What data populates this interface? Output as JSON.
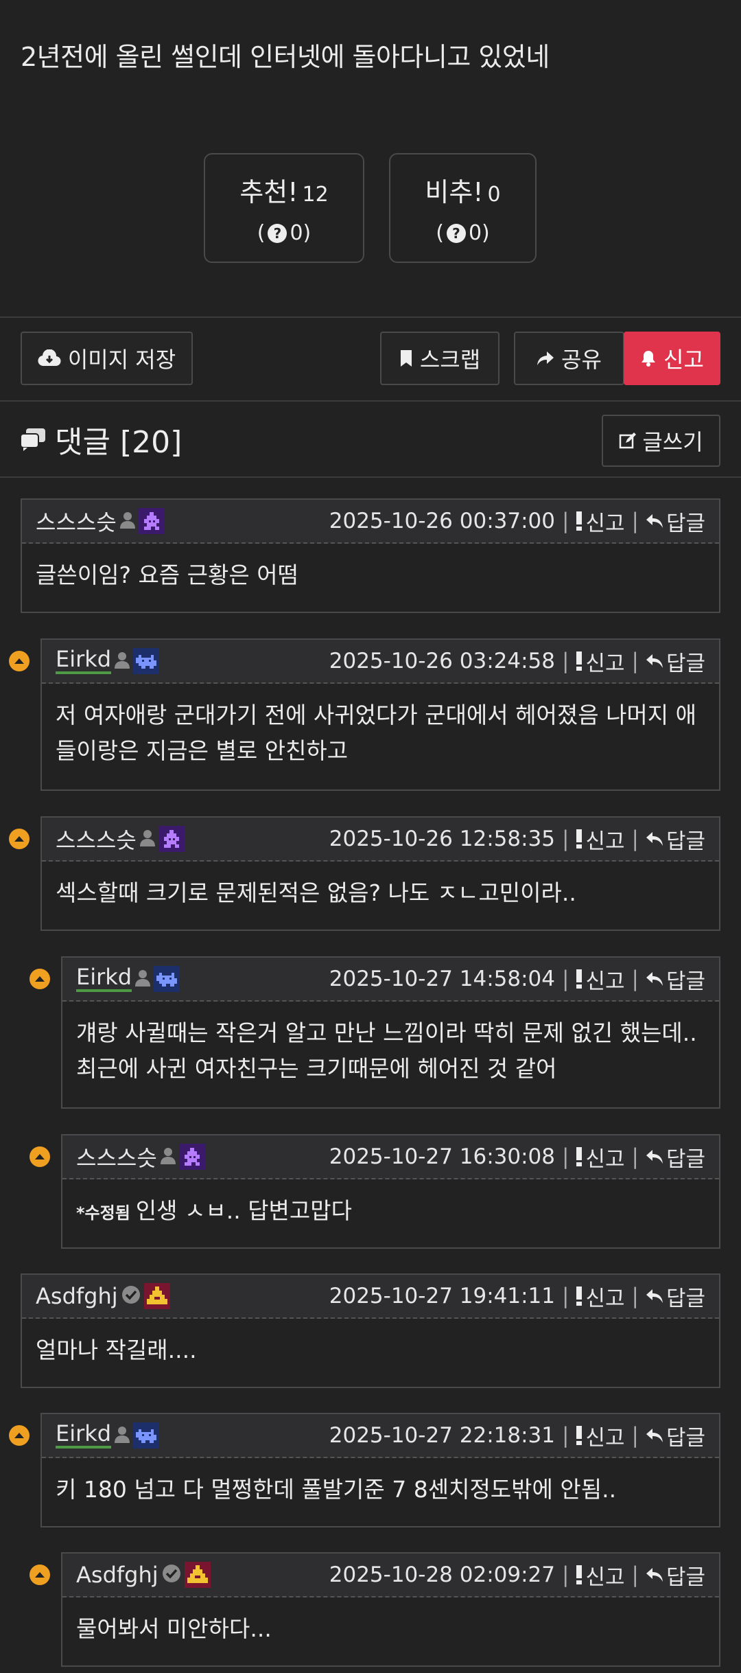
{
  "post": {
    "title": "2년전에 올린 썰인데 인터넷에 돌아다니고 있었네"
  },
  "votes": {
    "up": {
      "label": "추천!",
      "count": "12",
      "sub": "0"
    },
    "down": {
      "label": "비추!",
      "count": "0",
      "sub": "0"
    }
  },
  "toolbar": {
    "save_image": "이미지 저장",
    "scrap": "스크랩",
    "share": "공유",
    "report": "신고"
  },
  "comments_header": {
    "label": "댓글 [20]",
    "write": "글쓰기"
  },
  "colors": {
    "accent_red": "#e0344c",
    "reply_badge": "#f0a020",
    "underline_green": "#4f9a45"
  },
  "comment_actions": {
    "report": "신고",
    "reply": "답글"
  },
  "comments": [
    {
      "author": "스스스슷",
      "verified": false,
      "level_icon": "purple-invader-icon",
      "time": "2025-10-26 00:37:00",
      "text": "글쓴이임? 요즘 근황은 어떰",
      "depth": 0
    },
    {
      "author": "Eirkd",
      "verified": false,
      "level_icon": "blue-invader-icon",
      "time": "2025-10-26 03:24:58",
      "text": "저 여자애랑 군대가기 전에 사귀었다가 군대에서 헤어졌음 나머지 애들이랑은 지금은 별로 안친하고",
      "depth": 1
    },
    {
      "author": "스스스슷",
      "verified": false,
      "level_icon": "purple-invader-icon",
      "time": "2025-10-26 12:58:35",
      "text": "섹스할때 크기로 문제된적은 없음? 나도 ㅈㄴ고민이라..",
      "depth": 1
    },
    {
      "author": "Eirkd",
      "verified": false,
      "level_icon": "blue-invader-icon",
      "time": "2025-10-27 14:58:04",
      "text": "걔랑 사귈때는 작은거 알고 만난 느낌이라 딱히 문제 없긴 했는데.. 최근에 사귄 여자친구는 크기때문에 헤어진 것 같어",
      "depth": 2
    },
    {
      "author": "스스스슷",
      "verified": false,
      "level_icon": "purple-invader-icon",
      "time": "2025-10-27 16:30:08",
      "edited": "*수정됨",
      "text": "인생 ㅅㅂ.. 답변고맙다",
      "depth": 2
    },
    {
      "author": "Asdfghj",
      "verified": true,
      "level_icon": "gold-ship-icon",
      "time": "2025-10-27 19:41:11",
      "text": "얼마나 작길래....",
      "depth": 0
    },
    {
      "author": "Eirkd",
      "verified": false,
      "level_icon": "blue-invader-icon",
      "time": "2025-10-27 22:18:31",
      "text": "키 180 넘고 다 멀쩡한데 풀발기준 7 8센치정도밖에 안됨..",
      "depth": 1
    },
    {
      "author": "Asdfghj",
      "verified": true,
      "level_icon": "gold-ship-icon",
      "time": "2025-10-28 02:09:27",
      "text": "물어봐서 미안하다...",
      "depth": 2
    }
  ]
}
